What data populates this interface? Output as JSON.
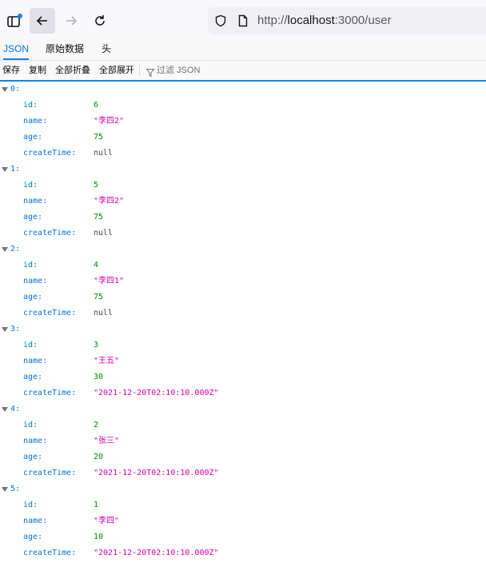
{
  "browser": {
    "url_prefix": "http://",
    "url_host": "localhost",
    "url_rest": ":3000/user"
  },
  "viewer": {
    "tabs": [
      {
        "label": "JSON"
      },
      {
        "label": "原始数据"
      },
      {
        "label": "头"
      }
    ],
    "toolbar": {
      "save_label": "保存",
      "copy_label": "复制",
      "collapse_all_label": "全部折叠",
      "expand_all_label": "全部展开",
      "filter_placeholder": "过滤 JSON"
    }
  },
  "json": [
    {
      "index": "0:",
      "fields": [
        {
          "key": "id:",
          "value": "6",
          "type": "num"
        },
        {
          "key": "name:",
          "value": "\"李四2\"",
          "type": "str"
        },
        {
          "key": "age:",
          "value": "75",
          "type": "num"
        },
        {
          "key": "createTime:",
          "value": "null",
          "type": "nul"
        }
      ]
    },
    {
      "index": "1:",
      "fields": [
        {
          "key": "id:",
          "value": "5",
          "type": "num"
        },
        {
          "key": "name:",
          "value": "\"李四2\"",
          "type": "str"
        },
        {
          "key": "age:",
          "value": "75",
          "type": "num"
        },
        {
          "key": "createTime:",
          "value": "null",
          "type": "nul"
        }
      ]
    },
    {
      "index": "2:",
      "fields": [
        {
          "key": "id:",
          "value": "4",
          "type": "num"
        },
        {
          "key": "name:",
          "value": "\"李四1\"",
          "type": "str"
        },
        {
          "key": "age:",
          "value": "75",
          "type": "num"
        },
        {
          "key": "createTime:",
          "value": "null",
          "type": "nul"
        }
      ]
    },
    {
      "index": "3:",
      "fields": [
        {
          "key": "id:",
          "value": "3",
          "type": "num"
        },
        {
          "key": "name:",
          "value": "\"王五\"",
          "type": "str"
        },
        {
          "key": "age:",
          "value": "30",
          "type": "num"
        },
        {
          "key": "createTime:",
          "value": "\"2021-12-20T02:10:10.000Z\"",
          "type": "str"
        }
      ]
    },
    {
      "index": "4:",
      "fields": [
        {
          "key": "id:",
          "value": "2",
          "type": "num"
        },
        {
          "key": "name:",
          "value": "\"张三\"",
          "type": "str"
        },
        {
          "key": "age:",
          "value": "20",
          "type": "num"
        },
        {
          "key": "createTime:",
          "value": "\"2021-12-20T02:10:10.000Z\"",
          "type": "str"
        }
      ]
    },
    {
      "index": "5:",
      "fields": [
        {
          "key": "id:",
          "value": "1",
          "type": "num"
        },
        {
          "key": "name:",
          "value": "\"李四\"",
          "type": "str"
        },
        {
          "key": "age:",
          "value": "10",
          "type": "num"
        },
        {
          "key": "createTime:",
          "value": "\"2021-12-20T02:10:10.000Z\"",
          "type": "str"
        }
      ]
    }
  ],
  "icons": {
    "sidebar": "sidebar-toggle-icon",
    "back": "arrow-left-icon",
    "forward": "arrow-right-icon",
    "reload": "reload-icon",
    "shield": "shield-icon",
    "page": "page-icon",
    "filter": "filter-icon",
    "twisty": "triangle-down-icon"
  },
  "colors": {
    "key": "#0074e8",
    "number": "#058b00",
    "string": "#dd00a9",
    "null": "#4a4a4f",
    "accent": "#0a84ff"
  }
}
